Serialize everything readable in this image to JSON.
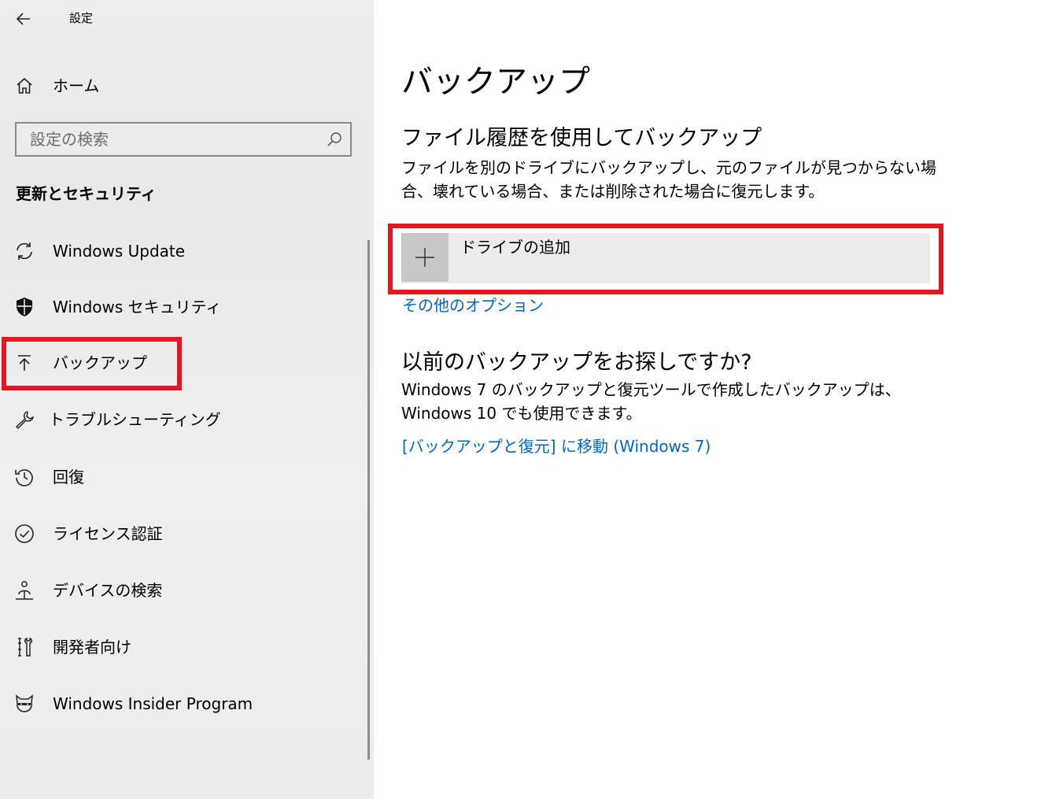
{
  "window": {
    "title": "設定"
  },
  "sidebar": {
    "home_label": "ホーム",
    "search": {
      "placeholder": "設定の検索"
    },
    "section_heading": "更新とセキュリティ",
    "items": [
      {
        "label": "Windows Update",
        "icon": "sync-icon"
      },
      {
        "label": "Windows セキュリティ",
        "icon": "shield-icon"
      },
      {
        "label": "バックアップ",
        "icon": "backup-arrow-up-icon",
        "selected": true
      },
      {
        "label": "トラブルシューティング",
        "icon": "wrench-icon"
      },
      {
        "label": "回復",
        "icon": "history-icon"
      },
      {
        "label": "ライセンス認証",
        "icon": "check-circle-icon"
      },
      {
        "label": "デバイスの検索",
        "icon": "person-location-icon"
      },
      {
        "label": "開発者向け",
        "icon": "developer-tools-icon"
      },
      {
        "label": "Windows Insider Program",
        "icon": "ninja-cat-icon"
      }
    ]
  },
  "main": {
    "title": "バックアップ",
    "file_history": {
      "heading": "ファイル履歴を使用してバックアップ",
      "description": "ファイルを別のドライブにバックアップし、元のファイルが見つからない場合、壊れている場合、または削除された場合に復元します。",
      "add_drive_label": "ドライブの追加",
      "more_options_link": "その他のオプション"
    },
    "older_backup": {
      "heading": "以前のバックアップをお探しですか?",
      "description": "Windows 7 のバックアップと復元ツールで作成したバックアップは、Windows 10 でも使用できます。",
      "link": "[バックアップと復元] に移動 (Windows 7)"
    }
  },
  "colors": {
    "accent_link": "#0067c0",
    "highlight_annotation": "#e5161f",
    "sidebar_bg": "#ececec"
  }
}
